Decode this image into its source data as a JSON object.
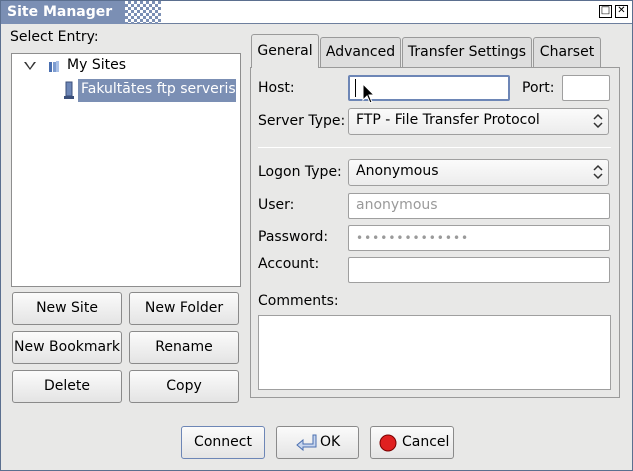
{
  "window": {
    "title": "Site Manager",
    "max_btn": "□",
    "close_btn": "✕"
  },
  "left": {
    "select_entry_label": "Select Entry:",
    "tree": {
      "root_label": "My Sites",
      "site_label": "Fakultātes ftp serveris"
    },
    "buttons": {
      "new_site": "New Site",
      "new_folder": "New Folder",
      "new_bookmark": "New Bookmark",
      "rename": "Rename",
      "delete": "Delete",
      "copy": "Copy"
    }
  },
  "tabs": [
    {
      "label": "General",
      "active": true
    },
    {
      "label": "Advanced",
      "active": false
    },
    {
      "label": "Transfer Settings",
      "active": false
    },
    {
      "label": "Charset",
      "active": false
    }
  ],
  "general": {
    "host_label": "Host:",
    "host_value": "",
    "port_label": "Port:",
    "port_value": "",
    "server_type_label": "Server Type:",
    "server_type_value": "FTP - File Transfer Protocol",
    "logon_type_label": "Logon Type:",
    "logon_type_value": "Anonymous",
    "user_label": "User:",
    "user_value": "anonymous",
    "password_label": "Password:",
    "password_value": "••••••••••••••",
    "account_label": "Account:",
    "account_value": "",
    "comments_label": "Comments:",
    "comments_value": ""
  },
  "footer": {
    "connect": "Connect",
    "ok": "OK",
    "cancel": "Cancel"
  },
  "colors": {
    "selection": "#7b8fb4",
    "cancel_icon": "#e02020",
    "ok_arrow": "#4a6fb0"
  }
}
